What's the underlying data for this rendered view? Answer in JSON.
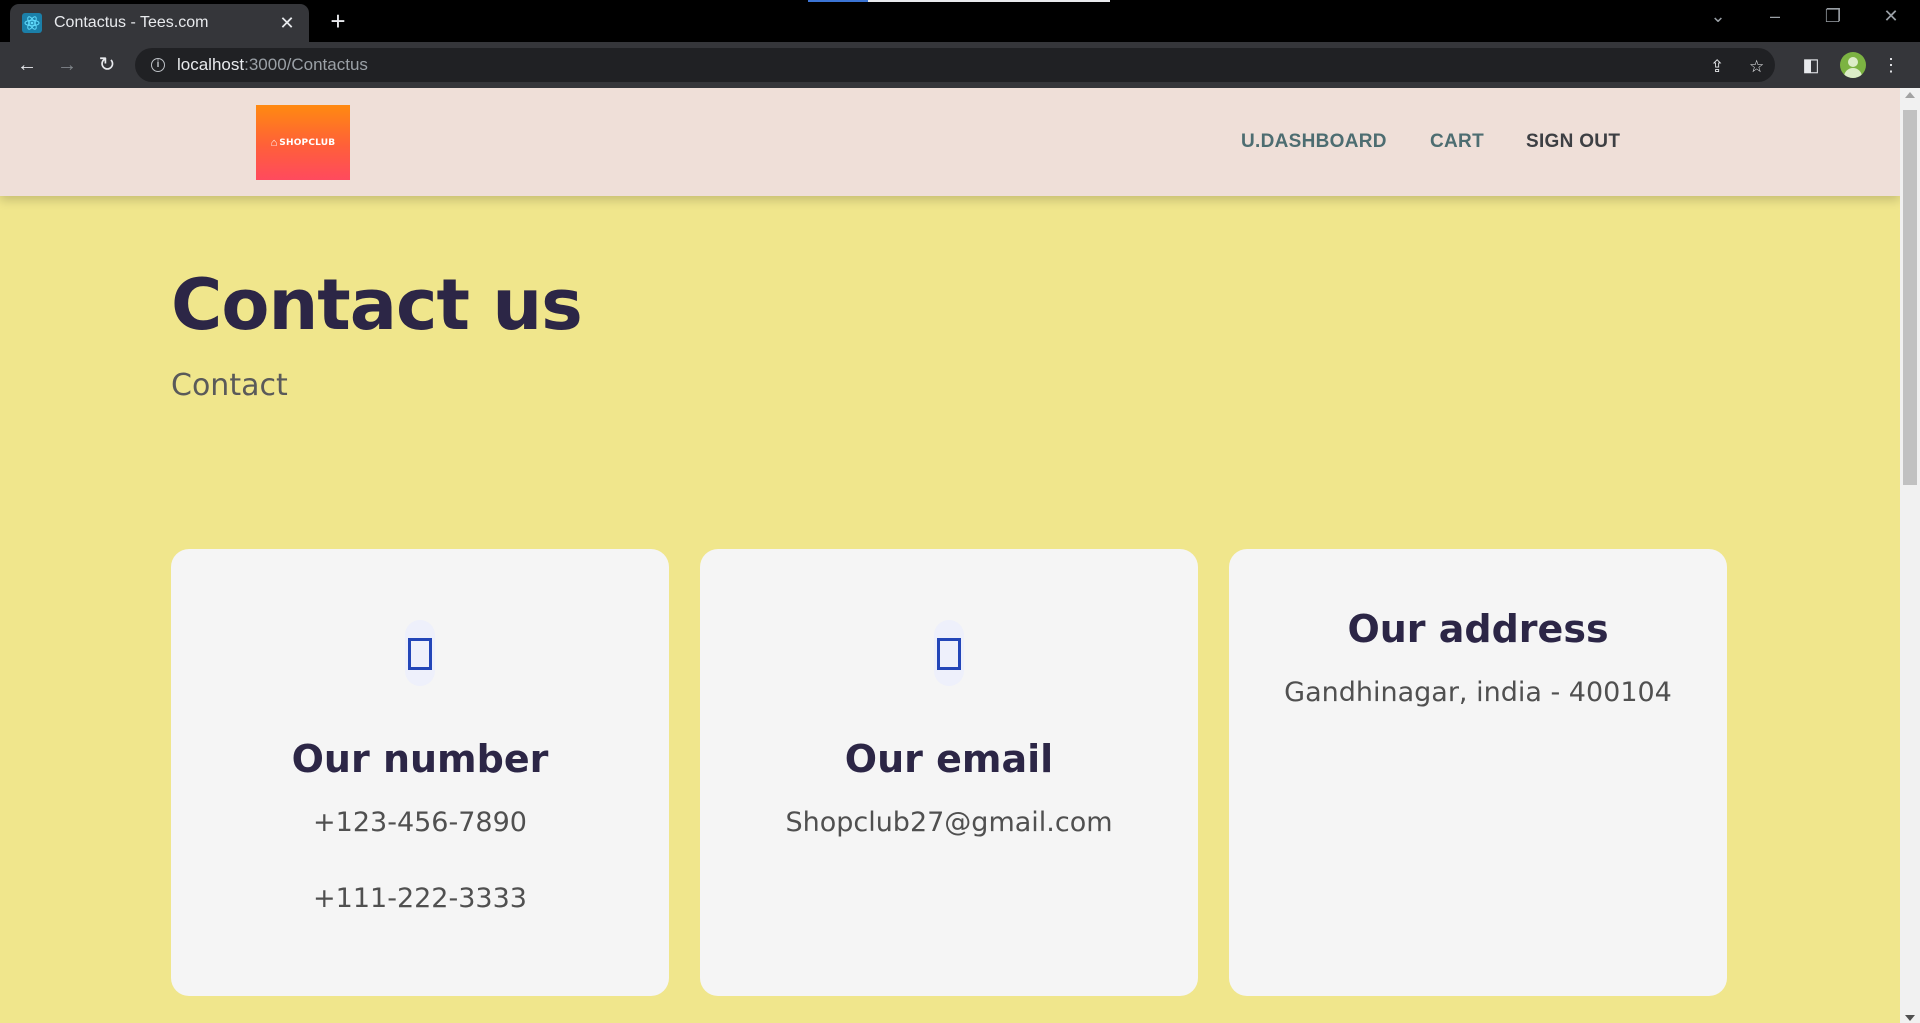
{
  "browser": {
    "tab_title": "Contactus - Tees.com",
    "tab_close": "✕",
    "new_tab": "+",
    "url_host": "localhost",
    "url_path": ":3000/Contactus"
  },
  "header": {
    "logo_text": "SHOPCLUB",
    "nav": {
      "dashboard": "U.DASHBOARD",
      "cart": "CART",
      "signout": "SIGN OUT"
    }
  },
  "main": {
    "title": "Contact us",
    "subtitle": "Contact"
  },
  "cards": {
    "number": {
      "icon": "phone-icon",
      "title": "Our number",
      "lines": [
        "+123-456-7890",
        "+111-222-3333"
      ]
    },
    "email": {
      "icon": "email-icon",
      "title": "Our email",
      "lines": [
        "Shopclub27@gmail.com"
      ]
    },
    "address": {
      "title": "Our address",
      "lines": [
        "Gandhinagar, india - 400104"
      ]
    }
  },
  "colors": {
    "page_background": "#f0e68c",
    "header_background": "#efdfd8",
    "heading": "#2c2646",
    "card_background": "#f5f5f5",
    "icon_accent": "#2346b8"
  }
}
